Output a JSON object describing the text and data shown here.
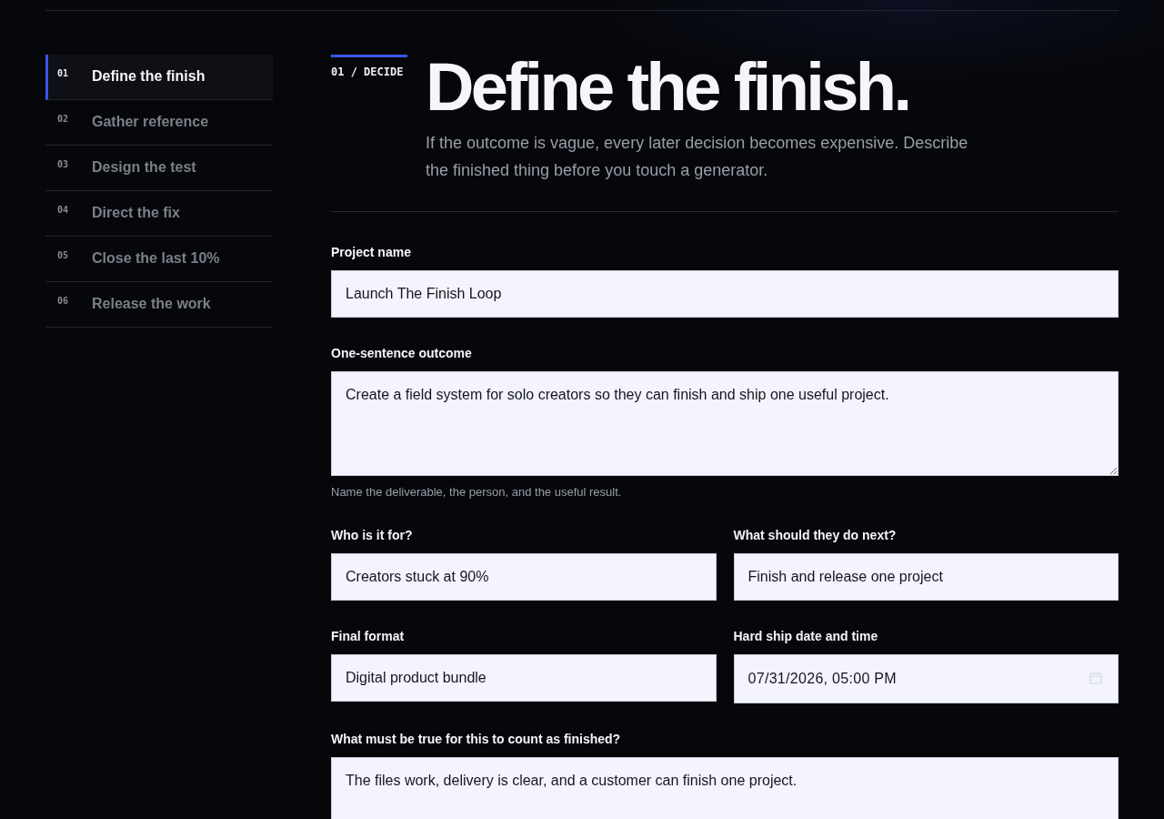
{
  "nav": {
    "items": [
      {
        "number": "01",
        "label": "Define the finish",
        "selected": true
      },
      {
        "number": "02",
        "label": "Gather reference",
        "selected": false
      },
      {
        "number": "03",
        "label": "Design the test",
        "selected": false
      },
      {
        "number": "04",
        "label": "Direct the fix",
        "selected": false
      },
      {
        "number": "05",
        "label": "Close the last 10%",
        "selected": false
      },
      {
        "number": "06",
        "label": "Release the work",
        "selected": false
      }
    ]
  },
  "header": {
    "kicker": "01 / DECIDE",
    "title": "Define the finish.",
    "intro": "If the outcome is vague, every later decision becomes expensive. Describe the finished thing before you touch a generator."
  },
  "form": {
    "rows": [
      {
        "fields": [
          {
            "kind": "text",
            "label": "Project name",
            "value": "Launch The Finish Loop"
          }
        ]
      },
      {
        "fields": [
          {
            "kind": "textarea",
            "label": "One-sentence outcome",
            "value": "Create a field system for solo creators so they can finish and ship one useful project.",
            "hint": "Name the deliverable, the person, and the useful result."
          }
        ]
      },
      {
        "fields": [
          {
            "kind": "text",
            "label": "Who is it for?",
            "value": "Creators stuck at 90%"
          },
          {
            "kind": "text",
            "label": "What should they do next?",
            "value": "Finish and release one project"
          }
        ]
      },
      {
        "fields": [
          {
            "kind": "text",
            "label": "Final format",
            "value": "Digital product bundle"
          },
          {
            "kind": "datetime",
            "label": "Hard ship date and time",
            "value": "07/31/2026, 05:00 PM"
          }
        ]
      },
      {
        "fields": [
          {
            "kind": "textarea",
            "label": "What must be true for this to count as finished?",
            "value": "The files work, delivery is clear, and a customer can finish one project."
          }
        ]
      }
    ]
  }
}
